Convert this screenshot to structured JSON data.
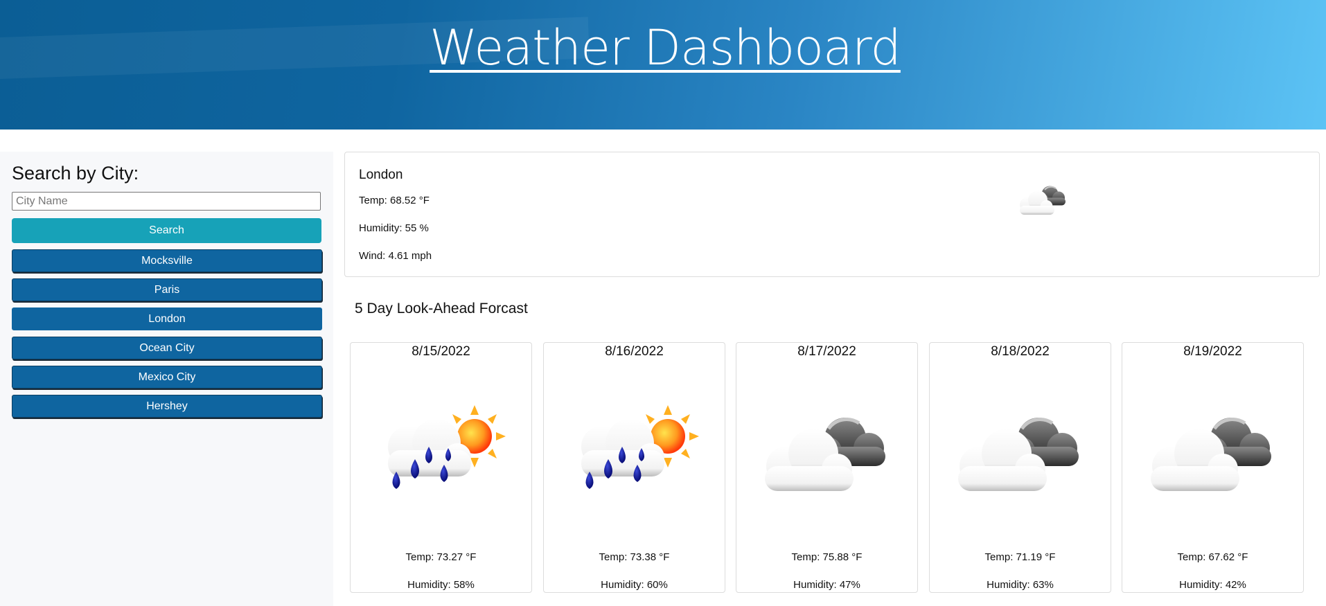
{
  "header": {
    "title": "Weather Dashboard"
  },
  "sidebar": {
    "heading": "Search by City:",
    "search_placeholder": "City Name",
    "search_value": "",
    "search_button": "Search",
    "history": [
      "Mocksville",
      "Paris",
      "London",
      "Ocean City",
      "Mexico City",
      "Hershey"
    ]
  },
  "current": {
    "city": "London",
    "temp": "Temp: 68.52 °F",
    "humidity": "Humidity: 55 %",
    "wind": "Wind: 4.61 mph",
    "icon": "cloudy-icon"
  },
  "forecast": {
    "title": "5 Day Look-Ahead Forcast",
    "days": [
      {
        "date": "8/15/2022",
        "temp": "Temp: 73.27 °F",
        "humidity": "Humidity: 58%",
        "icon": "rain-sun-icon"
      },
      {
        "date": "8/16/2022",
        "temp": "Temp: 73.38 °F",
        "humidity": "Humidity: 60%",
        "icon": "rain-sun-icon"
      },
      {
        "date": "8/17/2022",
        "temp": "Temp: 75.88 °F",
        "humidity": "Humidity: 47%",
        "icon": "cloudy-icon"
      },
      {
        "date": "8/18/2022",
        "temp": "Temp: 71.19 °F",
        "humidity": "Humidity: 63%",
        "icon": "cloudy-icon"
      },
      {
        "date": "8/19/2022",
        "temp": "Temp: 67.62 °F",
        "humidity": "Humidity: 42%",
        "icon": "cloudy-icon"
      }
    ]
  },
  "colors": {
    "header_start": "#0b5e95",
    "header_end": "#5cc3f5",
    "search_button": "#17a2b8",
    "history_button": "#0f65a0"
  }
}
